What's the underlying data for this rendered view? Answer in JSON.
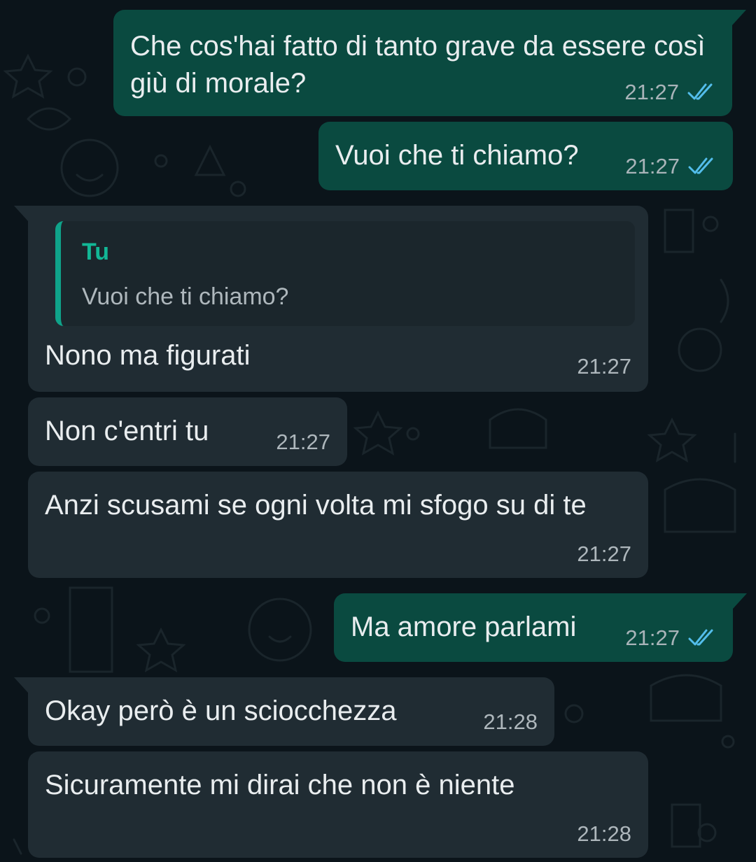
{
  "colors": {
    "background": "#0b141a",
    "outgoing_bubble": "#0a4a40",
    "incoming_bubble": "#202c33",
    "read_ticks": "#53bdeb",
    "quote_accent": "#12b796"
  },
  "messages": [
    {
      "direction": "outgoing",
      "text": "Che cos'hai fatto di tanto grave da essere così giù di morale?",
      "time": "21:27",
      "status": "read"
    },
    {
      "direction": "outgoing",
      "text": "Vuoi che ti chiamo?",
      "time": "21:27",
      "status": "read"
    },
    {
      "direction": "incoming",
      "quoted": {
        "author": "Tu",
        "text": "Vuoi che ti chiamo?"
      },
      "text": "Nono ma figurati",
      "time": "21:27"
    },
    {
      "direction": "incoming",
      "text": "Non c'entri tu",
      "time": "21:27"
    },
    {
      "direction": "incoming",
      "text": "Anzi scusami se ogni volta mi sfogo su di te",
      "time": "21:27"
    },
    {
      "direction": "outgoing",
      "text": "Ma amore parlami",
      "time": "21:27",
      "status": "read"
    },
    {
      "direction": "incoming",
      "text": "Okay però è un sciocchezza",
      "time": "21:28"
    },
    {
      "direction": "incoming",
      "text": "Sicuramente mi dirai che non è niente",
      "time": "21:28"
    }
  ]
}
